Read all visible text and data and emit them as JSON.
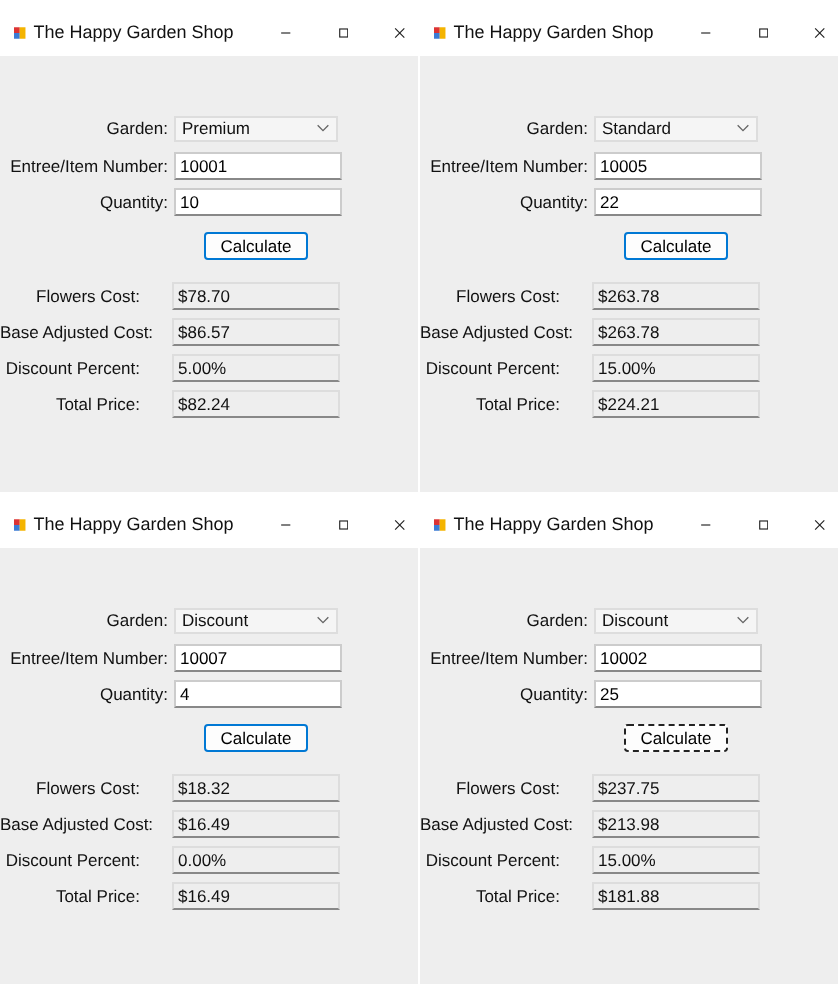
{
  "windows": [
    {
      "title": "The Happy Garden Shop",
      "garden": "Premium",
      "item_number": "10001",
      "quantity": "10",
      "button": {
        "label": "Calculate",
        "focused": false
      },
      "outputs": [
        {
          "label": "Flowers Cost:",
          "value": "$78.70"
        },
        {
          "label": "Base Adjusted Cost:",
          "value": "$86.57"
        },
        {
          "label": "Discount Percent:",
          "value": "5.00%"
        },
        {
          "label": "Total Price:",
          "value": "$82.24"
        }
      ],
      "labels": {
        "garden": "Garden:",
        "item_number": "Entree/Item Number:",
        "quantity": "Quantity:"
      }
    },
    {
      "title": "The Happy Garden Shop",
      "garden": "Standard",
      "item_number": "10005",
      "quantity": "22",
      "button": {
        "label": "Calculate",
        "focused": false
      },
      "outputs": [
        {
          "label": "Flowers Cost:",
          "value": "$263.78"
        },
        {
          "label": "Base Adjusted Cost:",
          "value": "$263.78"
        },
        {
          "label": "Discount Percent:",
          "value": "15.00%"
        },
        {
          "label": "Total Price:",
          "value": "$224.21"
        }
      ],
      "labels": {
        "garden": "Garden:",
        "item_number": "Entree/Item Number:",
        "quantity": "Quantity:"
      }
    },
    {
      "title": "The Happy Garden Shop",
      "garden": "Discount",
      "item_number": "10007",
      "quantity": "4",
      "button": {
        "label": "Calculate",
        "focused": false
      },
      "outputs": [
        {
          "label": "Flowers Cost:",
          "value": "$18.32"
        },
        {
          "label": "Base Adjusted Cost:",
          "value": "$16.49"
        },
        {
          "label": "Discount Percent:",
          "value": "0.00%"
        },
        {
          "label": "Total Price:",
          "value": "$16.49"
        }
      ],
      "labels": {
        "garden": "Garden:",
        "item_number": "Entree/Item Number:",
        "quantity": "Quantity:"
      }
    },
    {
      "title": "The Happy Garden Shop",
      "garden": "Discount",
      "item_number": "10002",
      "quantity": "25",
      "button": {
        "label": "Calculate",
        "focused": true
      },
      "outputs": [
        {
          "label": "Flowers Cost:",
          "value": "$237.75"
        },
        {
          "label": "Base Adjusted Cost:",
          "value": "$213.98"
        },
        {
          "label": "Discount Percent:",
          "value": "15.00%"
        },
        {
          "label": "Total Price:",
          "value": "$181.88"
        }
      ],
      "labels": {
        "garden": "Garden:",
        "item_number": "Entree/Item Number:",
        "quantity": "Quantity:"
      }
    }
  ]
}
